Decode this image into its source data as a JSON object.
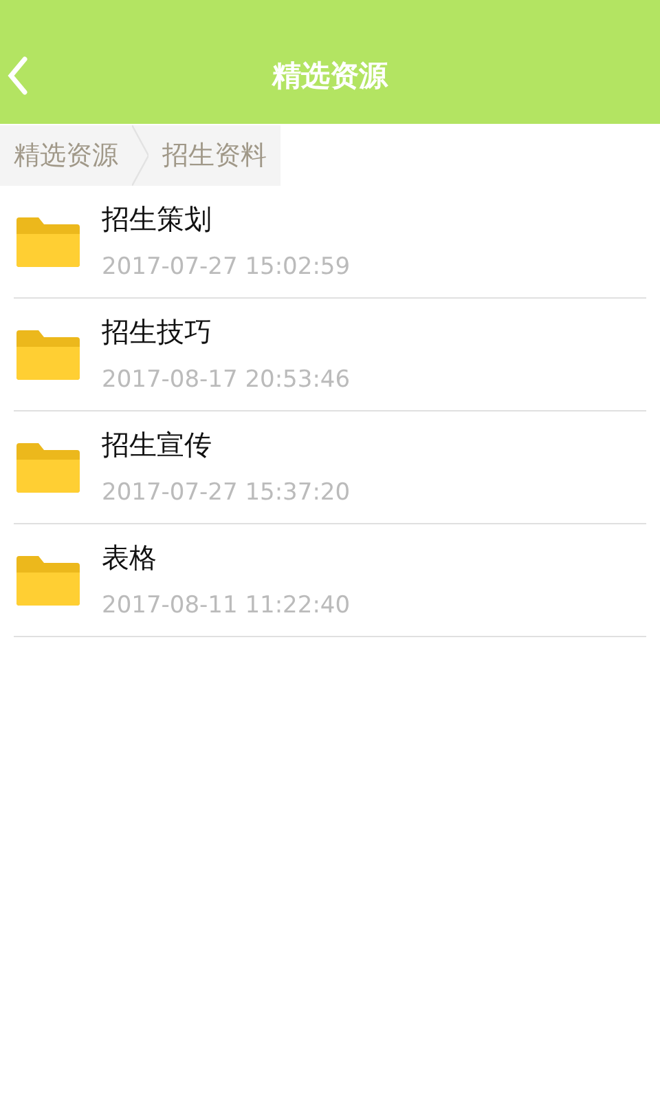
{
  "header": {
    "title": "精选资源"
  },
  "breadcrumb": [
    "精选资源",
    "招生资料"
  ],
  "folders": [
    {
      "name": "招生策划",
      "time": "2017-07-27 15:02:59"
    },
    {
      "name": "招生技巧",
      "time": "2017-08-17 20:53:46"
    },
    {
      "name": "招生宣传",
      "time": "2017-07-27 15:37:20"
    },
    {
      "name": "表格",
      "time": "2017-08-11 11:22:40"
    }
  ]
}
